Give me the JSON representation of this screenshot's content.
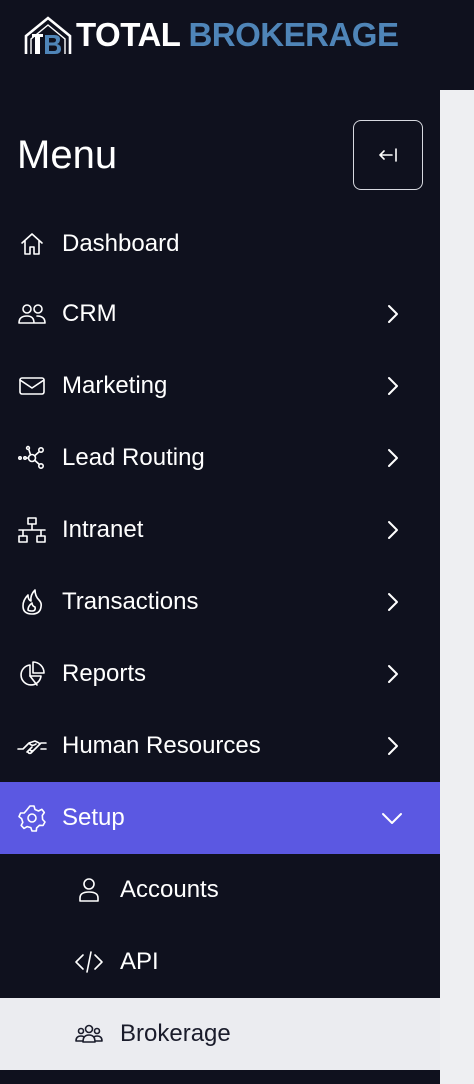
{
  "header": {
    "logo_monogram": "TB",
    "logo_word_1": "TOTAL",
    "logo_word_2": "BROKERAGE",
    "brand_color": "#4f85b8"
  },
  "sidebar": {
    "title": "Menu",
    "collapse_icon": "collapse-left-icon",
    "active_color": "#5b58e2",
    "items": [
      {
        "label": "Dashboard",
        "icon": "home-icon",
        "has_children": false
      },
      {
        "label": "CRM",
        "icon": "users-icon",
        "has_children": true
      },
      {
        "label": "Marketing",
        "icon": "envelope-icon",
        "has_children": true
      },
      {
        "label": "Lead Routing",
        "icon": "share-nodes-icon",
        "has_children": true
      },
      {
        "label": "Intranet",
        "icon": "network-icon",
        "has_children": true
      },
      {
        "label": "Transactions",
        "icon": "fire-icon",
        "has_children": true
      },
      {
        "label": "Reports",
        "icon": "pie-chart-icon",
        "has_children": true
      },
      {
        "label": "Human Resources",
        "icon": "handshake-icon",
        "has_children": true
      },
      {
        "label": "Setup",
        "icon": "gear-icon",
        "has_children": true,
        "expanded": true,
        "active": true
      }
    ],
    "setup_children": [
      {
        "label": "Accounts",
        "icon": "user-icon"
      },
      {
        "label": "API",
        "icon": "code-icon"
      },
      {
        "label": "Brokerage",
        "icon": "user-group-icon",
        "highlighted": true
      }
    ]
  }
}
